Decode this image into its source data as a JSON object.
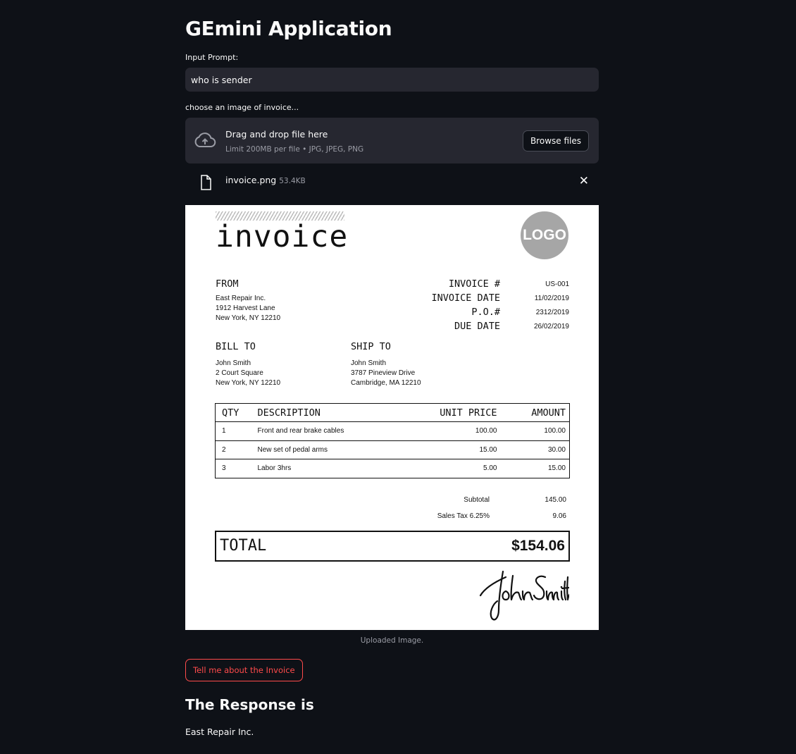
{
  "app": {
    "title": "GEmini Application"
  },
  "prompt": {
    "label": "Input Prompt:",
    "value": "who is sender"
  },
  "uploader": {
    "label": "choose an image of invoice...",
    "drag_text": "Drag and drop file here",
    "limit_text": "Limit 200MB per file • JPG, JPEG, PNG",
    "browse_label": "Browse files",
    "file_name": "invoice.png",
    "file_size": "53.4KB",
    "remove_icon": "close-icon"
  },
  "invoice": {
    "title": "invoice",
    "logo_text": "LOGO",
    "from": {
      "label": "FROM",
      "line1": "East Repair Inc.",
      "line2": "1912 Harvest Lane",
      "line3": "New York, NY 12210"
    },
    "meta": [
      {
        "label": "INVOICE #",
        "value": "US-001"
      },
      {
        "label": "INVOICE DATE",
        "value": "11/02/2019"
      },
      {
        "label": "P.O.#",
        "value": "2312/2019"
      },
      {
        "label": "DUE DATE",
        "value": "26/02/2019"
      }
    ],
    "bill_to": {
      "label": "BILL TO",
      "line1": "John Smith",
      "line2": "2 Court Square",
      "line3": "New York, NY 12210"
    },
    "ship_to": {
      "label": "SHIP TO",
      "line1": "John Smith",
      "line2": "3787 Pineview Drive",
      "line3": "Cambridge, MA 12210"
    },
    "table": {
      "headers": [
        "QTY",
        "DESCRIPTION",
        "UNIT PRICE",
        "AMOUNT"
      ],
      "rows": [
        [
          "1",
          "Front and rear brake cables",
          "100.00",
          "100.00"
        ],
        [
          "2",
          "New set of pedal arms",
          "15.00",
          "30.00"
        ],
        [
          "3",
          "Labor 3hrs",
          "5.00",
          "15.00"
        ]
      ]
    },
    "subtotal_label": "Subtotal",
    "subtotal_value": "145.00",
    "tax_label": "Sales Tax 6.25%",
    "tax_value": "9.06",
    "total_label": "TOTAL",
    "total_value": "$154.06",
    "signature": "John Smith"
  },
  "image_caption": "Uploaded Image.",
  "action_button": "Tell me about the Invoice",
  "response": {
    "heading": "The Response is",
    "text": "East Repair Inc."
  }
}
